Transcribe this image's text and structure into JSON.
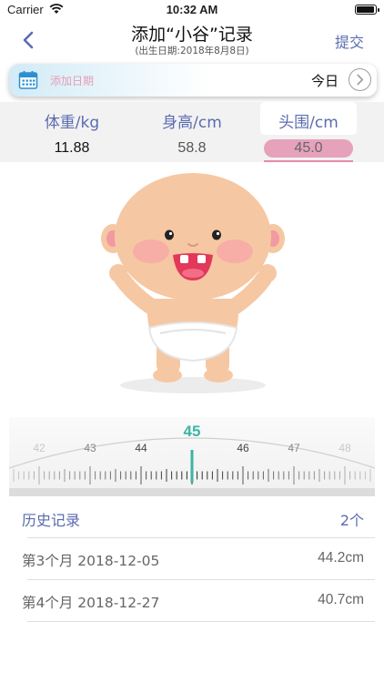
{
  "status": {
    "carrier": "Carrier",
    "time": "10:32 AM",
    "battery_level": 0.95
  },
  "nav": {
    "title": "添加“小谷”记录",
    "subtitle": "(出生日期:2018年8月8日)",
    "submit_label": "提交"
  },
  "date": {
    "placeholder": "添加日期",
    "value": "今日"
  },
  "tabs": [
    {
      "label": "体重/kg",
      "value": "11.88",
      "active": false
    },
    {
      "label": "身高/cm",
      "value": "58.8",
      "active": false
    },
    {
      "label": "头围/cm",
      "value": "45.0",
      "active": true
    }
  ],
  "ruler": {
    "current_value": "45",
    "tick_labels": [
      "42",
      "43",
      "44",
      "46",
      "47",
      "48"
    ],
    "accent_color": "#3ab6a6"
  },
  "history": {
    "title": "历史记录",
    "count": "2个",
    "records": [
      {
        "label": "第3个月 2018-12-05",
        "value": "44.2cm"
      },
      {
        "label": "第4个月 2018-12-27",
        "value": "40.7cm"
      }
    ]
  },
  "colors": {
    "primary": "#5b6bb0",
    "pink": "#e6a2bb",
    "teal": "#3ab6a6"
  }
}
